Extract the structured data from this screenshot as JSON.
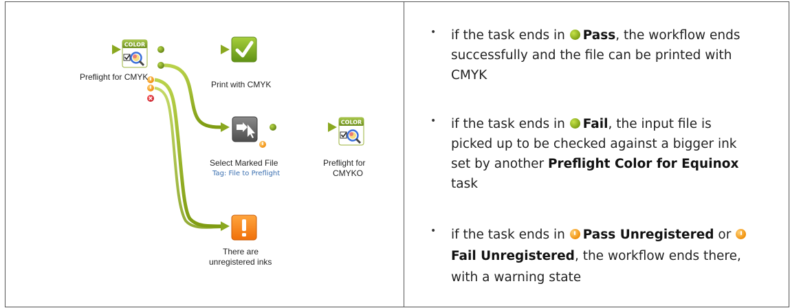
{
  "diagram": {
    "nodes": {
      "preflight_cmyk": {
        "label": "Preflight for CMYK",
        "icon": "color-preflight-icon"
      },
      "print_cmyk": {
        "label": "Print with CMYK",
        "icon": "green-checkmark-icon"
      },
      "select_marked": {
        "label": "Select Marked File",
        "tag": "Tag: File to Preflight",
        "icon": "select-marked-file-icon"
      },
      "preflight_cmyko": {
        "label_line1": "Preflight for",
        "label_line2": "CMYKO",
        "icon": "color-preflight-icon"
      },
      "unregistered": {
        "label_line1": "There are",
        "label_line2": "unregistered inks",
        "icon": "orange-warning-icon"
      }
    },
    "icon_text": "COLOR",
    "colors": {
      "connector": "#8aa820",
      "pass_dot": "#6d8e16",
      "warning": "#f39a1a",
      "error": "#d9202c"
    }
  },
  "bullets": [
    {
      "prefix": "if the task ends in ",
      "state": "Pass",
      "state_icon": "green",
      "suffix": ", the workflow ends successfully and the file can be printed with CMYK"
    },
    {
      "prefix": "if the task ends in ",
      "state": "Fail",
      "state_icon": "green",
      "mid": ", the input file is picked up to be checked against a bigger ink set by another ",
      "task": "Preflight Color for Equinox",
      "suffix": " task"
    },
    {
      "prefix": "if the task ends in ",
      "state": "Pass Unregistered",
      "state_icon": "orange",
      "or": "or ",
      "state2": "Fail Unregistered",
      "suffix": ", the workflow ends there, with a warning state"
    }
  ],
  "bullet_glyph": "•"
}
